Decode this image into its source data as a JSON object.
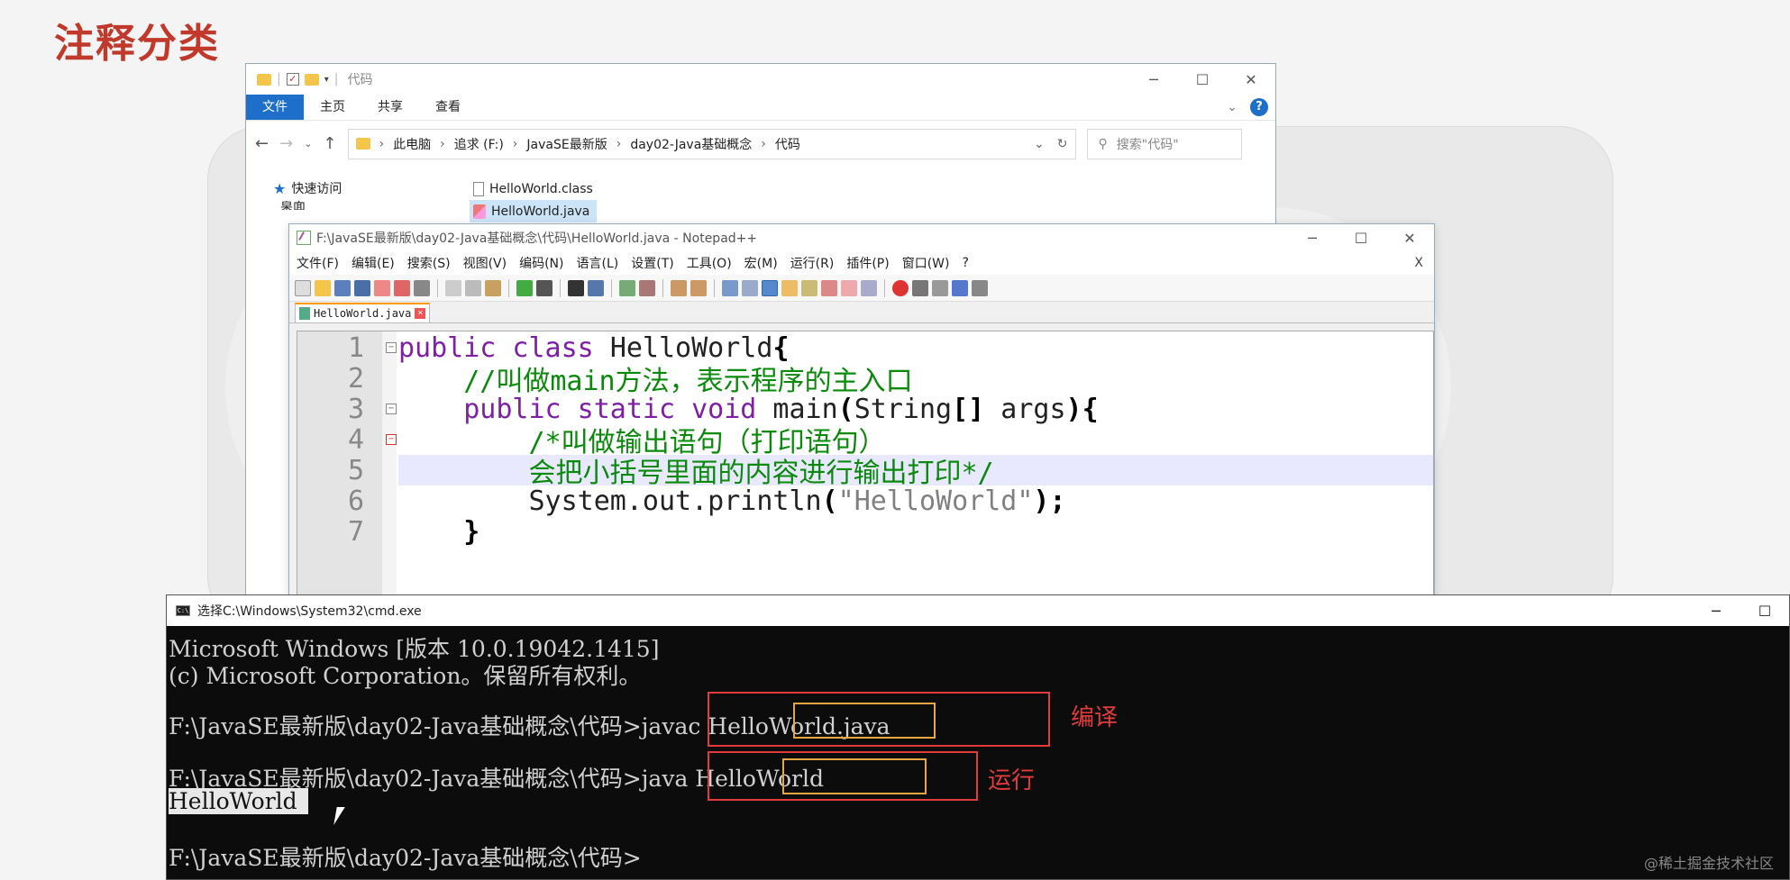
{
  "slide": {
    "title": "注释分类",
    "watermark": "@稀土掘金技术社区"
  },
  "explorer": {
    "title": "代码",
    "ribbon_tabs": [
      "文件",
      "主页",
      "共享",
      "查看"
    ],
    "address": {
      "crumbs": [
        "此电脑",
        "追求 (F:)",
        "JavaSE最新版",
        "day02-Java基础概念",
        "代码"
      ]
    },
    "search_placeholder": "搜索\"代码\"",
    "nav": {
      "quick_access": "快速访问",
      "desktop": "桌面"
    },
    "files": [
      {
        "name": "HelloWorld.class",
        "selected": false
      },
      {
        "name": "HelloWorld.java",
        "selected": true
      }
    ]
  },
  "notepad": {
    "title": "F:\\JavaSE最新版\\day02-Java基础概念\\代码\\HelloWorld.java - Notepad++",
    "menu": [
      "文件(F)",
      "编辑(E)",
      "搜索(S)",
      "视图(V)",
      "编码(N)",
      "语言(L)",
      "设置(T)",
      "工具(O)",
      "宏(M)",
      "运行(R)",
      "插件(P)",
      "窗口(W)",
      "?"
    ],
    "menu_close": "X",
    "tab": "HelloWorld.java",
    "lines": [
      {
        "num": "1",
        "parts": [
          {
            "t": "public class ",
            "c": "kw"
          },
          {
            "t": "HelloWorld",
            "c": "cls"
          },
          {
            "t": "{",
            "c": "op"
          }
        ]
      },
      {
        "num": "2",
        "parts": [
          {
            "t": "    //叫做main方法，表示程序的主入口",
            "c": "cm"
          }
        ]
      },
      {
        "num": "3",
        "parts": [
          {
            "t": "    public static void ",
            "c": "kw"
          },
          {
            "t": "main",
            "c": "cls"
          },
          {
            "t": "(",
            "c": "op"
          },
          {
            "t": "String",
            "c": "cls"
          },
          {
            "t": "[]",
            "c": "op"
          },
          {
            "t": " args",
            "c": "cls"
          },
          {
            "t": "){",
            "c": "op"
          }
        ]
      },
      {
        "num": "4",
        "parts": [
          {
            "t": "        /*叫做输出语句（打印语句）",
            "c": "cm"
          }
        ]
      },
      {
        "num": "5",
        "parts": [
          {
            "t": "        会把小括号里面的内容进行输出打印*/",
            "c": "cm"
          }
        ]
      },
      {
        "num": "6",
        "parts": [
          {
            "t": "        System.out.println",
            "c": "cls"
          },
          {
            "t": "(",
            "c": "op"
          },
          {
            "t": "\"HelloWorld\"",
            "c": "str"
          },
          {
            "t": ");",
            "c": "op"
          }
        ]
      },
      {
        "num": "7",
        "parts": [
          {
            "t": "    }",
            "c": "op"
          }
        ]
      }
    ]
  },
  "cmd": {
    "title": "选择C:\\Windows\\System32\\cmd.exe",
    "line1": "Microsoft Windows [版本 10.0.19042.1415]",
    "line2": "(c) Microsoft Corporation。保留所有权利。",
    "prompt": "F:\\JavaSE最新版\\day02-Java基础概念\\代码>",
    "cmd_compile": "javac HelloWorld.java",
    "cmd_run": "java HelloWorld",
    "output": "HelloWorld",
    "annot_compile": "编译",
    "annot_run": "运行"
  },
  "colors": {
    "accent_red": "#e23b3b",
    "accent_orange": "#e8a640",
    "title_red": "#c0392b",
    "explorer_blue": "#1e6fc9"
  }
}
